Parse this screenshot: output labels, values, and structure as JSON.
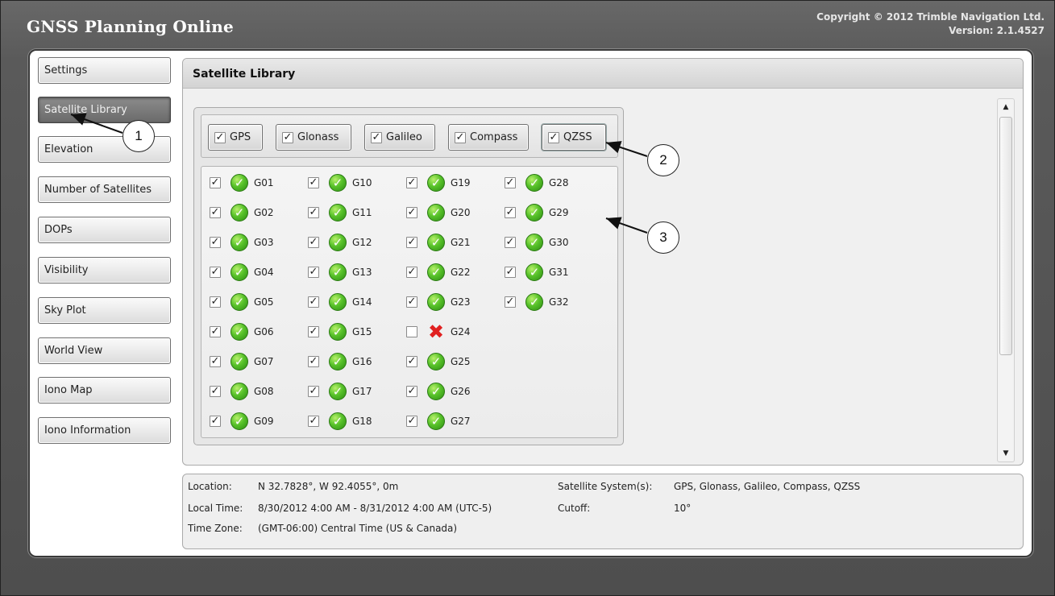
{
  "app": {
    "title": "GNSS Planning Online",
    "copyright": "Copyright ©  2012 Trimble Navigation Ltd.",
    "version": "Version: 2.1.4527"
  },
  "sidebar": {
    "items": [
      {
        "label": "Settings"
      },
      {
        "label": "Satellite Library",
        "active": true
      },
      {
        "label": "Elevation"
      },
      {
        "label": "Number of Satellites"
      },
      {
        "label": "DOPs"
      },
      {
        "label": "Visibility"
      },
      {
        "label": "Sky Plot"
      },
      {
        "label": "World View"
      },
      {
        "label": "Iono Map"
      },
      {
        "label": "Iono Information"
      }
    ]
  },
  "content": {
    "title": "Satellite Library",
    "systems": [
      {
        "label": "GPS",
        "checked": true
      },
      {
        "label": "Glonass",
        "checked": true
      },
      {
        "label": "Galileo",
        "checked": true
      },
      {
        "label": "Compass",
        "checked": true
      },
      {
        "label": "QZSS",
        "checked": true
      }
    ],
    "satellites": [
      {
        "id": "G01",
        "checked": true,
        "ok": true
      },
      {
        "id": "G02",
        "checked": true,
        "ok": true
      },
      {
        "id": "G03",
        "checked": true,
        "ok": true
      },
      {
        "id": "G04",
        "checked": true,
        "ok": true
      },
      {
        "id": "G05",
        "checked": true,
        "ok": true
      },
      {
        "id": "G06",
        "checked": true,
        "ok": true
      },
      {
        "id": "G07",
        "checked": true,
        "ok": true
      },
      {
        "id": "G08",
        "checked": true,
        "ok": true
      },
      {
        "id": "G09",
        "checked": true,
        "ok": true
      },
      {
        "id": "G10",
        "checked": true,
        "ok": true
      },
      {
        "id": "G11",
        "checked": true,
        "ok": true
      },
      {
        "id": "G12",
        "checked": true,
        "ok": true
      },
      {
        "id": "G13",
        "checked": true,
        "ok": true
      },
      {
        "id": "G14",
        "checked": true,
        "ok": true
      },
      {
        "id": "G15",
        "checked": true,
        "ok": true
      },
      {
        "id": "G16",
        "checked": true,
        "ok": true
      },
      {
        "id": "G17",
        "checked": true,
        "ok": true
      },
      {
        "id": "G18",
        "checked": true,
        "ok": true
      },
      {
        "id": "G19",
        "checked": true,
        "ok": true
      },
      {
        "id": "G20",
        "checked": true,
        "ok": true
      },
      {
        "id": "G21",
        "checked": true,
        "ok": true
      },
      {
        "id": "G22",
        "checked": true,
        "ok": true
      },
      {
        "id": "G23",
        "checked": true,
        "ok": true
      },
      {
        "id": "G24",
        "checked": false,
        "ok": false
      },
      {
        "id": "G25",
        "checked": true,
        "ok": true
      },
      {
        "id": "G26",
        "checked": true,
        "ok": true
      },
      {
        "id": "G27",
        "checked": true,
        "ok": true
      },
      {
        "id": "G28",
        "checked": true,
        "ok": true
      },
      {
        "id": "G29",
        "checked": true,
        "ok": true
      },
      {
        "id": "G30",
        "checked": true,
        "ok": true
      },
      {
        "id": "G31",
        "checked": true,
        "ok": true
      },
      {
        "id": "G32",
        "checked": true,
        "ok": true
      }
    ]
  },
  "info": {
    "location_label": "Location:",
    "location_value": "N 32.7828°, W 92.4055°, 0m",
    "local_time_label": "Local Time:",
    "local_time_value": "8/30/2012 4:00 AM - 8/31/2012 4:00 AM (UTC-5)",
    "time_zone_label": "Time Zone:",
    "time_zone_value": "(GMT-06:00) Central Time (US & Canada)",
    "systems_label": "Satellite System(s):",
    "systems_value": "GPS, Glonass, Galileo, Compass, QZSS",
    "cutoff_label": "Cutoff:",
    "cutoff_value": "10°"
  },
  "callouts": [
    "1",
    "2",
    "3"
  ],
  "colors": {
    "ok_green": "#4caf28",
    "error_red": "#e02020",
    "frame": "#5a5a5a"
  }
}
